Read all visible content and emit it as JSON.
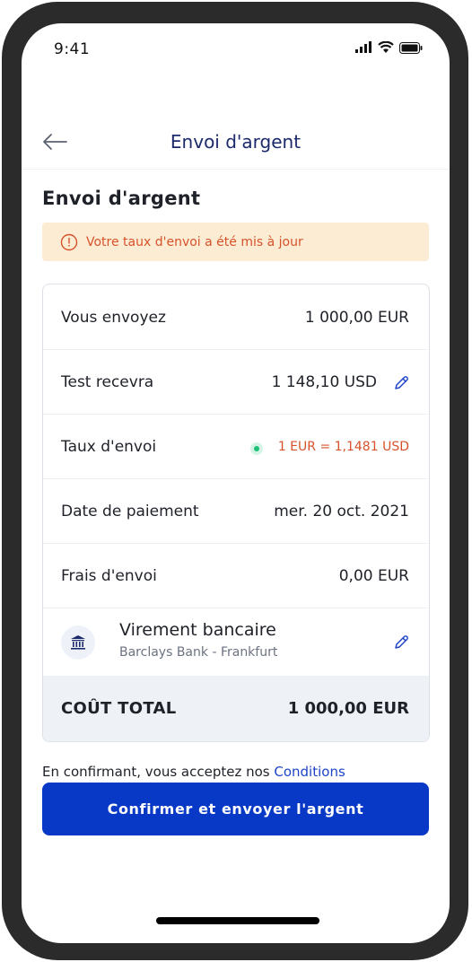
{
  "status_bar": {
    "time": "9:41"
  },
  "header": {
    "title": "Envoi d'argent"
  },
  "page": {
    "title": "Envoi d'argent"
  },
  "alert": {
    "text": "Votre taux d'envoi a été mis à jour"
  },
  "summary": {
    "send_label": "Vous envoyez",
    "send_value": "1 000,00 EUR",
    "receive_label": "Test recevra",
    "receive_value": "1 148,10 USD",
    "rate_label": "Taux d'envoi",
    "rate_value": "1 EUR = 1,1481 USD",
    "date_label": "Date de paiement",
    "date_value": "mer. 20 oct. 2021",
    "fees_label": "Frais d'envoi",
    "fees_value": "0,00 EUR",
    "method_title": "Virement bancaire",
    "method_subtitle": "Barclays Bank - Frankfurt",
    "total_label": "COÛT TOTAL",
    "total_value": "1 000,00 EUR"
  },
  "terms": {
    "prefix": "En confirmant, vous acceptez nos ",
    "link": "Conditions"
  },
  "actions": {
    "confirm_label": "Confirmer et envoyer l'argent"
  },
  "colors": {
    "primary": "#0739c6",
    "header_text": "#1c2a6b",
    "warning_bg": "#fcecd4",
    "warning_text": "#d7522b",
    "rate_dot": "#1fbf77",
    "total_bg": "#eef2f7"
  },
  "icons": [
    "back-arrow-icon",
    "warning-circle-icon",
    "pencil-icon",
    "bank-icon",
    "signal-icon",
    "wifi-icon",
    "battery-icon"
  ]
}
